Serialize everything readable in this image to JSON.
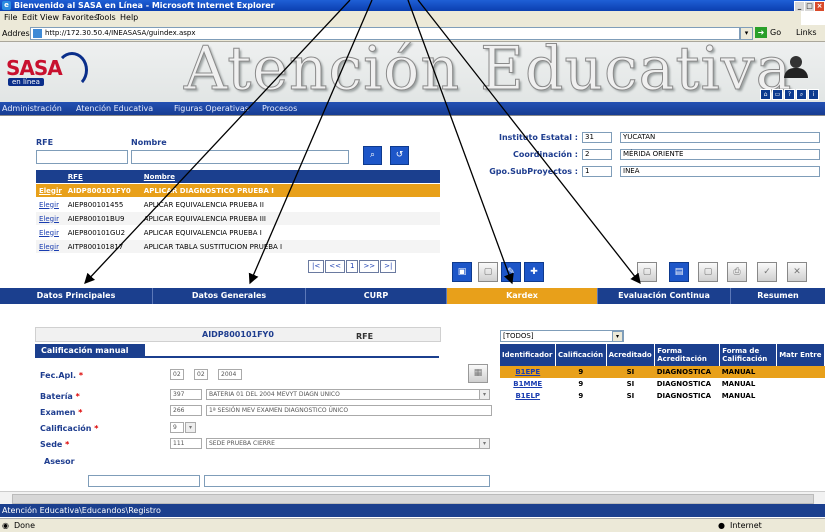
{
  "window": {
    "title": "Bienvenido al SASA en Línea - Microsoft Internet Explorer",
    "controls": [
      "_",
      "□",
      "×"
    ]
  },
  "menu": [
    "File",
    "Edit",
    "View",
    "Favorites",
    "Tools",
    "Help"
  ],
  "address": {
    "label": "Address",
    "url": "http://172.30.50.4/INEASASA/guindex.aspx",
    "go": "Go",
    "links": "Links"
  },
  "banner": {
    "logo_main": "SASA",
    "logo_sub": "en línea",
    "title": "Atención Educativa"
  },
  "nav": [
    "Administración",
    "Atención Educativa",
    "Figuras Operativas",
    "Procesos"
  ],
  "search": {
    "rfe_label": "RFE",
    "nombre_label": "Nombre",
    "rfe_value": "",
    "nombre_value": ""
  },
  "rfe_table": {
    "headers": [
      "",
      "RFE",
      "Nombre"
    ],
    "rows": [
      {
        "action": "Elegir",
        "rfe": "AIDP800101FY0",
        "nombre": "APLICAR DIAGNOSTICO PRUEBA I"
      },
      {
        "action": "Elegir",
        "rfe": "AIEP800101455",
        "nombre": "APLICAR EQUIVALENCIA PRUEBA II"
      },
      {
        "action": "Elegir",
        "rfe": "AIEP800101BU9",
        "nombre": "APLICAR EQUIVALENCIA PRUEBA III"
      },
      {
        "action": "Elegir",
        "rfe": "AIEP800101GU2",
        "nombre": "APLICAR EQUIVALENCIA PRUEBA I"
      },
      {
        "action": "Elegir",
        "rfe": "AITP800101817",
        "nombre": "APLICAR TABLA SUSTITUCION PRUEBA I"
      }
    ],
    "pager": {
      "first": "|<",
      "prev": "<<",
      "page": "1",
      "next": ">>",
      "last": ">|"
    }
  },
  "institute": {
    "estatal_label": "Instituto Estatal :",
    "estatal_code": "31",
    "estatal_value": "YUCATAN",
    "coord_label": "Coordinación :",
    "coord_code": "2",
    "coord_value": "MÉRIDA ORIENTE",
    "gpo_label": "Gpo.SubProyectos :",
    "gpo_code": "1",
    "gpo_value": "INEA"
  },
  "tabs": [
    {
      "label": "Datos Principales",
      "active": false
    },
    {
      "label": "Datos Generales",
      "active": false
    },
    {
      "label": "CURP",
      "active": false
    },
    {
      "label": "Kardex",
      "active": true
    },
    {
      "label": "Evaluación Continua",
      "active": false
    },
    {
      "label": "Resumen",
      "active": false
    }
  ],
  "form": {
    "rfe_title_label": "RFE",
    "rfe_title_value": "AIDP800101FY0",
    "section_title": "Calificación manual",
    "fec_label": "Fec.Apl.",
    "fec_day": "02",
    "fec_month": "02",
    "fec_year": "2004",
    "bateria_label": "Batería",
    "bateria_code": "397",
    "bateria_value": "BATERIA 01 DEL 2004 MEVYT DIAGN UNICO",
    "examen_label": "Examen",
    "examen_code": "266",
    "examen_value": "1ª SESIÓN MEV EXAMEN DIAGNOSTICO ÚNICO",
    "calif_label": "Calificación",
    "calif_value": "9",
    "sede_label": "Sede",
    "sede_code": "111",
    "sede_value": "SEDE PRUEBA CIERRE",
    "asesor_label": "Asesor",
    "required_mark": "*"
  },
  "grid": {
    "filter": "[TODOS]",
    "headers": [
      "Identificador",
      "Calificación",
      "Acreditado",
      "Forma Acreditación",
      "Forma de Calificación",
      "Matr Entre"
    ],
    "rows": [
      {
        "id": "B1EPE",
        "calif": "9",
        "acred": "SI",
        "forma": "DIAGNOSTICA",
        "forma_cal": "MANUAL"
      },
      {
        "id": "B1MME",
        "calif": "9",
        "acred": "SI",
        "forma": "DIAGNOSTICA",
        "forma_cal": "MANUAL"
      },
      {
        "id": "B1ELP",
        "calif": "9",
        "acred": "SI",
        "forma": "DIAGNOSTICA",
        "forma_cal": "MANUAL"
      }
    ]
  },
  "path": "Atención Educativa\\Educandos\\Registro",
  "status": {
    "left": "Done",
    "zone": "Internet"
  },
  "colors": {
    "nav_blue": "#1b3f8e",
    "active_orange": "#e8a01a",
    "title_blue": "#0b3fb0"
  }
}
